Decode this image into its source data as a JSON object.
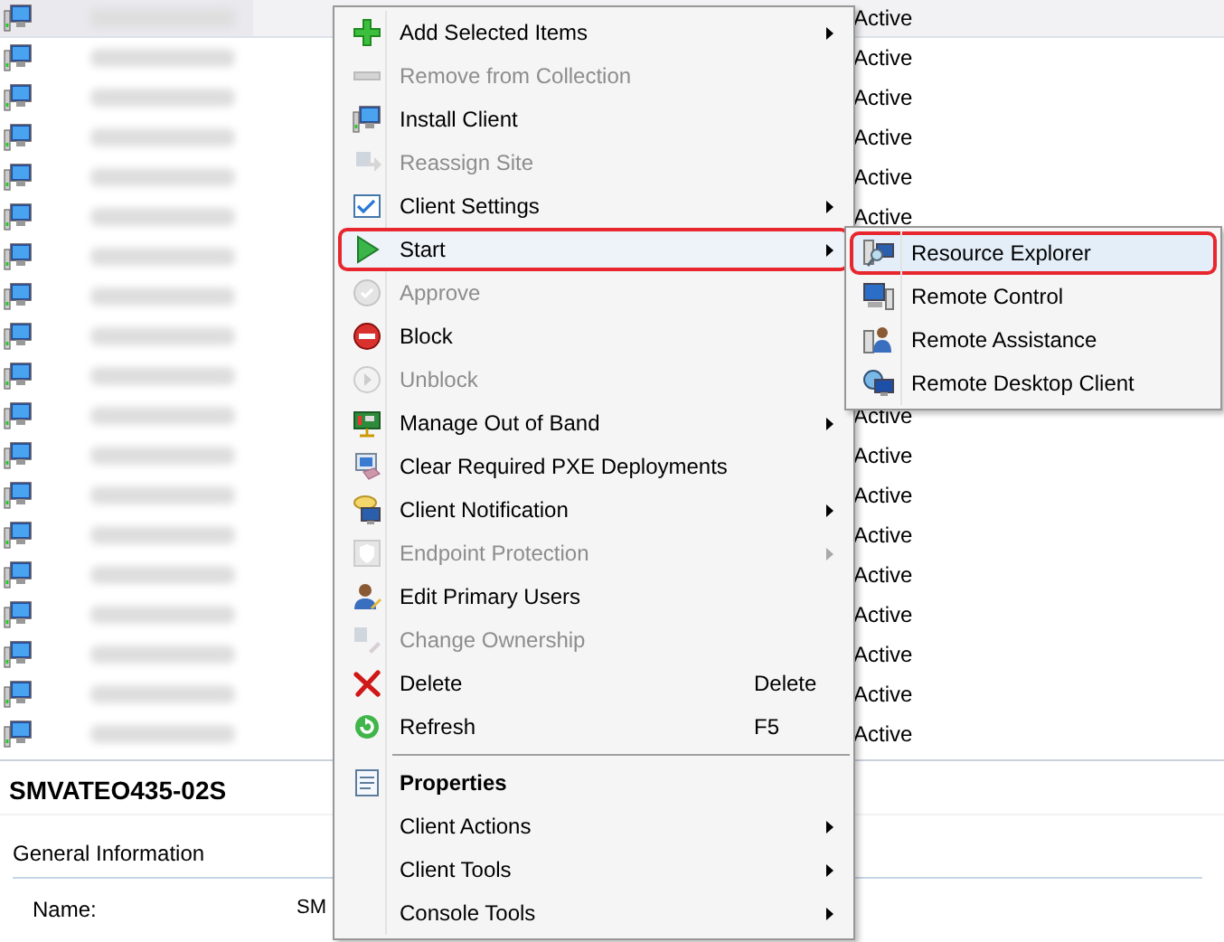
{
  "list": {
    "rows": [
      {
        "status": "Active",
        "selected": true
      },
      {
        "status": "Active",
        "selected": false
      },
      {
        "status": "Active",
        "selected": false
      },
      {
        "status": "Active",
        "selected": false
      },
      {
        "status": "Active",
        "selected": false
      },
      {
        "status": "Active",
        "selected": false
      },
      {
        "selected": false
      },
      {
        "selected": false
      },
      {
        "selected": false
      },
      {
        "selected": false
      },
      {
        "status": "Active",
        "selected": false
      },
      {
        "status": "Active",
        "selected": false
      },
      {
        "status": "Active",
        "selected": false
      },
      {
        "status": "Active",
        "selected": false
      },
      {
        "status": "Active",
        "selected": false
      },
      {
        "status": "Active",
        "selected": false
      },
      {
        "status": "Active",
        "selected": false
      },
      {
        "status": "Active",
        "selected": false
      },
      {
        "status": "Active",
        "selected": false
      }
    ]
  },
  "details": {
    "title": "SMVATEO435-02S",
    "section": "General Information",
    "fields": [
      {
        "label": "Name:",
        "value": "SM"
      }
    ]
  },
  "context_menu": {
    "groups": [
      [
        {
          "label": "Add Selected Items",
          "disabled": false,
          "has_submenu": true,
          "selected": false
        },
        {
          "label": "Remove from Collection",
          "disabled": true,
          "has_submenu": false,
          "selected": false
        },
        {
          "label": "Install Client",
          "disabled": false,
          "has_submenu": false,
          "selected": false
        },
        {
          "label": "Reassign Site",
          "disabled": true,
          "has_submenu": false,
          "selected": false
        },
        {
          "label": "Client Settings",
          "disabled": false,
          "has_submenu": true,
          "selected": false
        },
        {
          "label": "Start",
          "disabled": false,
          "has_submenu": true,
          "selected": true
        },
        {
          "label": "Approve",
          "disabled": true,
          "has_submenu": false,
          "selected": false
        },
        {
          "label": "Block",
          "disabled": false,
          "has_submenu": false,
          "selected": false
        },
        {
          "label": "Unblock",
          "disabled": true,
          "has_submenu": false,
          "selected": false
        },
        {
          "label": "Manage Out of Band",
          "disabled": false,
          "has_submenu": true,
          "selected": false
        },
        {
          "label": "Clear Required PXE Deployments",
          "disabled": false,
          "has_submenu": false,
          "selected": false
        },
        {
          "label": "Client Notification",
          "disabled": false,
          "has_submenu": true,
          "selected": false
        },
        {
          "label": "Endpoint Protection",
          "disabled": true,
          "has_submenu": true,
          "selected": false
        },
        {
          "label": "Edit Primary Users",
          "disabled": false,
          "has_submenu": false,
          "selected": false
        },
        {
          "label": "Change Ownership",
          "disabled": true,
          "has_submenu": false,
          "selected": false
        },
        {
          "label": "Delete",
          "shortcut": "Delete",
          "disabled": false,
          "has_submenu": false,
          "selected": false
        },
        {
          "label": "Refresh",
          "shortcut": "F5",
          "disabled": false,
          "has_submenu": false,
          "selected": false
        }
      ],
      [
        {
          "label": "Properties",
          "default": true,
          "disabled": false,
          "has_submenu": false,
          "selected": false
        },
        {
          "label": "Client Actions",
          "default": false,
          "disabled": false,
          "has_submenu": true,
          "selected": false
        },
        {
          "label": "Client Tools",
          "default": false,
          "disabled": false,
          "has_submenu": true,
          "selected": false
        },
        {
          "label": "Console Tools",
          "default": false,
          "disabled": false,
          "has_submenu": true,
          "selected": false
        }
      ]
    ]
  },
  "submenu": {
    "items": [
      {
        "label": "Resource Explorer",
        "selected": true
      },
      {
        "label": "Remote Control",
        "selected": false
      },
      {
        "label": "Remote Assistance",
        "selected": false
      },
      {
        "label": "Remote Desktop Client",
        "selected": false
      }
    ]
  }
}
